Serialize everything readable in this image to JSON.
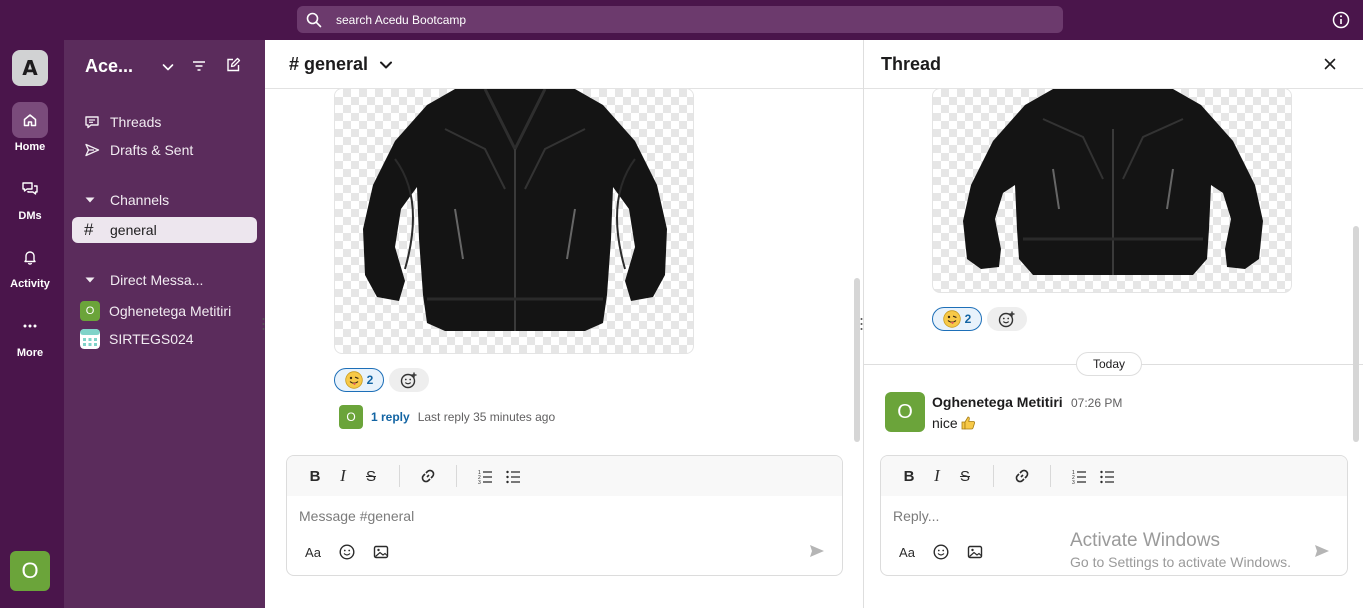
{
  "topbar": {
    "search_placeholder": "search Acedu Bootcamp"
  },
  "rail": {
    "workspace_initial": "A",
    "items": [
      {
        "label": "Home",
        "icon": "home-icon"
      },
      {
        "label": "DMs",
        "icon": "dm-icon"
      },
      {
        "label": "Activity",
        "icon": "bell-icon"
      },
      {
        "label": "More",
        "icon": "more-icon"
      }
    ],
    "user_initial": "O"
  },
  "sidebar": {
    "workspace_name": "Ace...",
    "threads_label": "Threads",
    "drafts_label": "Drafts & Sent",
    "channels_header": "Channels",
    "channels": [
      {
        "prefix": "#",
        "name": "general"
      }
    ],
    "dm_header": "Direct Messa...",
    "dms": [
      {
        "name": "Oghenetega Metitiri",
        "initial": "O"
      },
      {
        "name": "SIRTEGS024"
      }
    ]
  },
  "channel": {
    "title": "# general",
    "reaction_count": "2",
    "reply_avatar": "O",
    "reply_count": "1 reply",
    "reply_time": "Last reply 35 minutes ago",
    "composer_placeholder": "Message #general"
  },
  "thread": {
    "title": "Thread",
    "reaction_count": "2",
    "date_divider": "Today",
    "message": {
      "author_initial": "O",
      "author": "Oghenetega Metitiri",
      "time": "07:26 PM",
      "text": "nice"
    },
    "composer_placeholder": "Reply..."
  },
  "watermark": {
    "line1": "Activate Windows",
    "line2": "Go to Settings to activate Windows."
  },
  "colors": {
    "rail": "#4a154b",
    "sidebar": "#5b2c5c",
    "accent_link": "#1264a3",
    "avatar_green": "#6ba43a"
  }
}
